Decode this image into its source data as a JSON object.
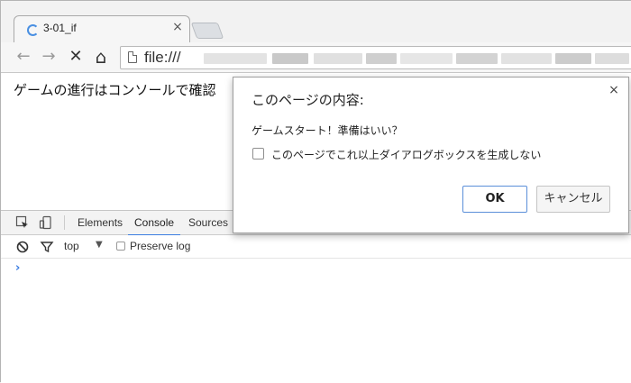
{
  "browser": {
    "tab_title": "3-01_if",
    "tab_close_glyph": "×",
    "back_glyph": "←",
    "forward_glyph": "→",
    "stop_glyph": "✕",
    "home_glyph": "⌂",
    "url": "file:///"
  },
  "page": {
    "text": "ゲームの進行はコンソールで確認"
  },
  "devtools": {
    "tabs": [
      "Elements",
      "Console",
      "Sources"
    ],
    "active_tab": "Console",
    "context": "top",
    "context_arrow": "▼",
    "preserve_log_label": "Preserve log",
    "prompt_glyph": "›"
  },
  "dialog": {
    "title": "このページの内容:",
    "close_glyph": "×",
    "message": "ゲームスタート！準備はいい？",
    "checkbox_label": "このページでこれ以上ダイアログボックスを生成しない",
    "ok_label": "OK",
    "cancel_label": "キャンセル"
  },
  "colors": {
    "accent": "#3b7de1",
    "spinner": "#4a90e2"
  }
}
